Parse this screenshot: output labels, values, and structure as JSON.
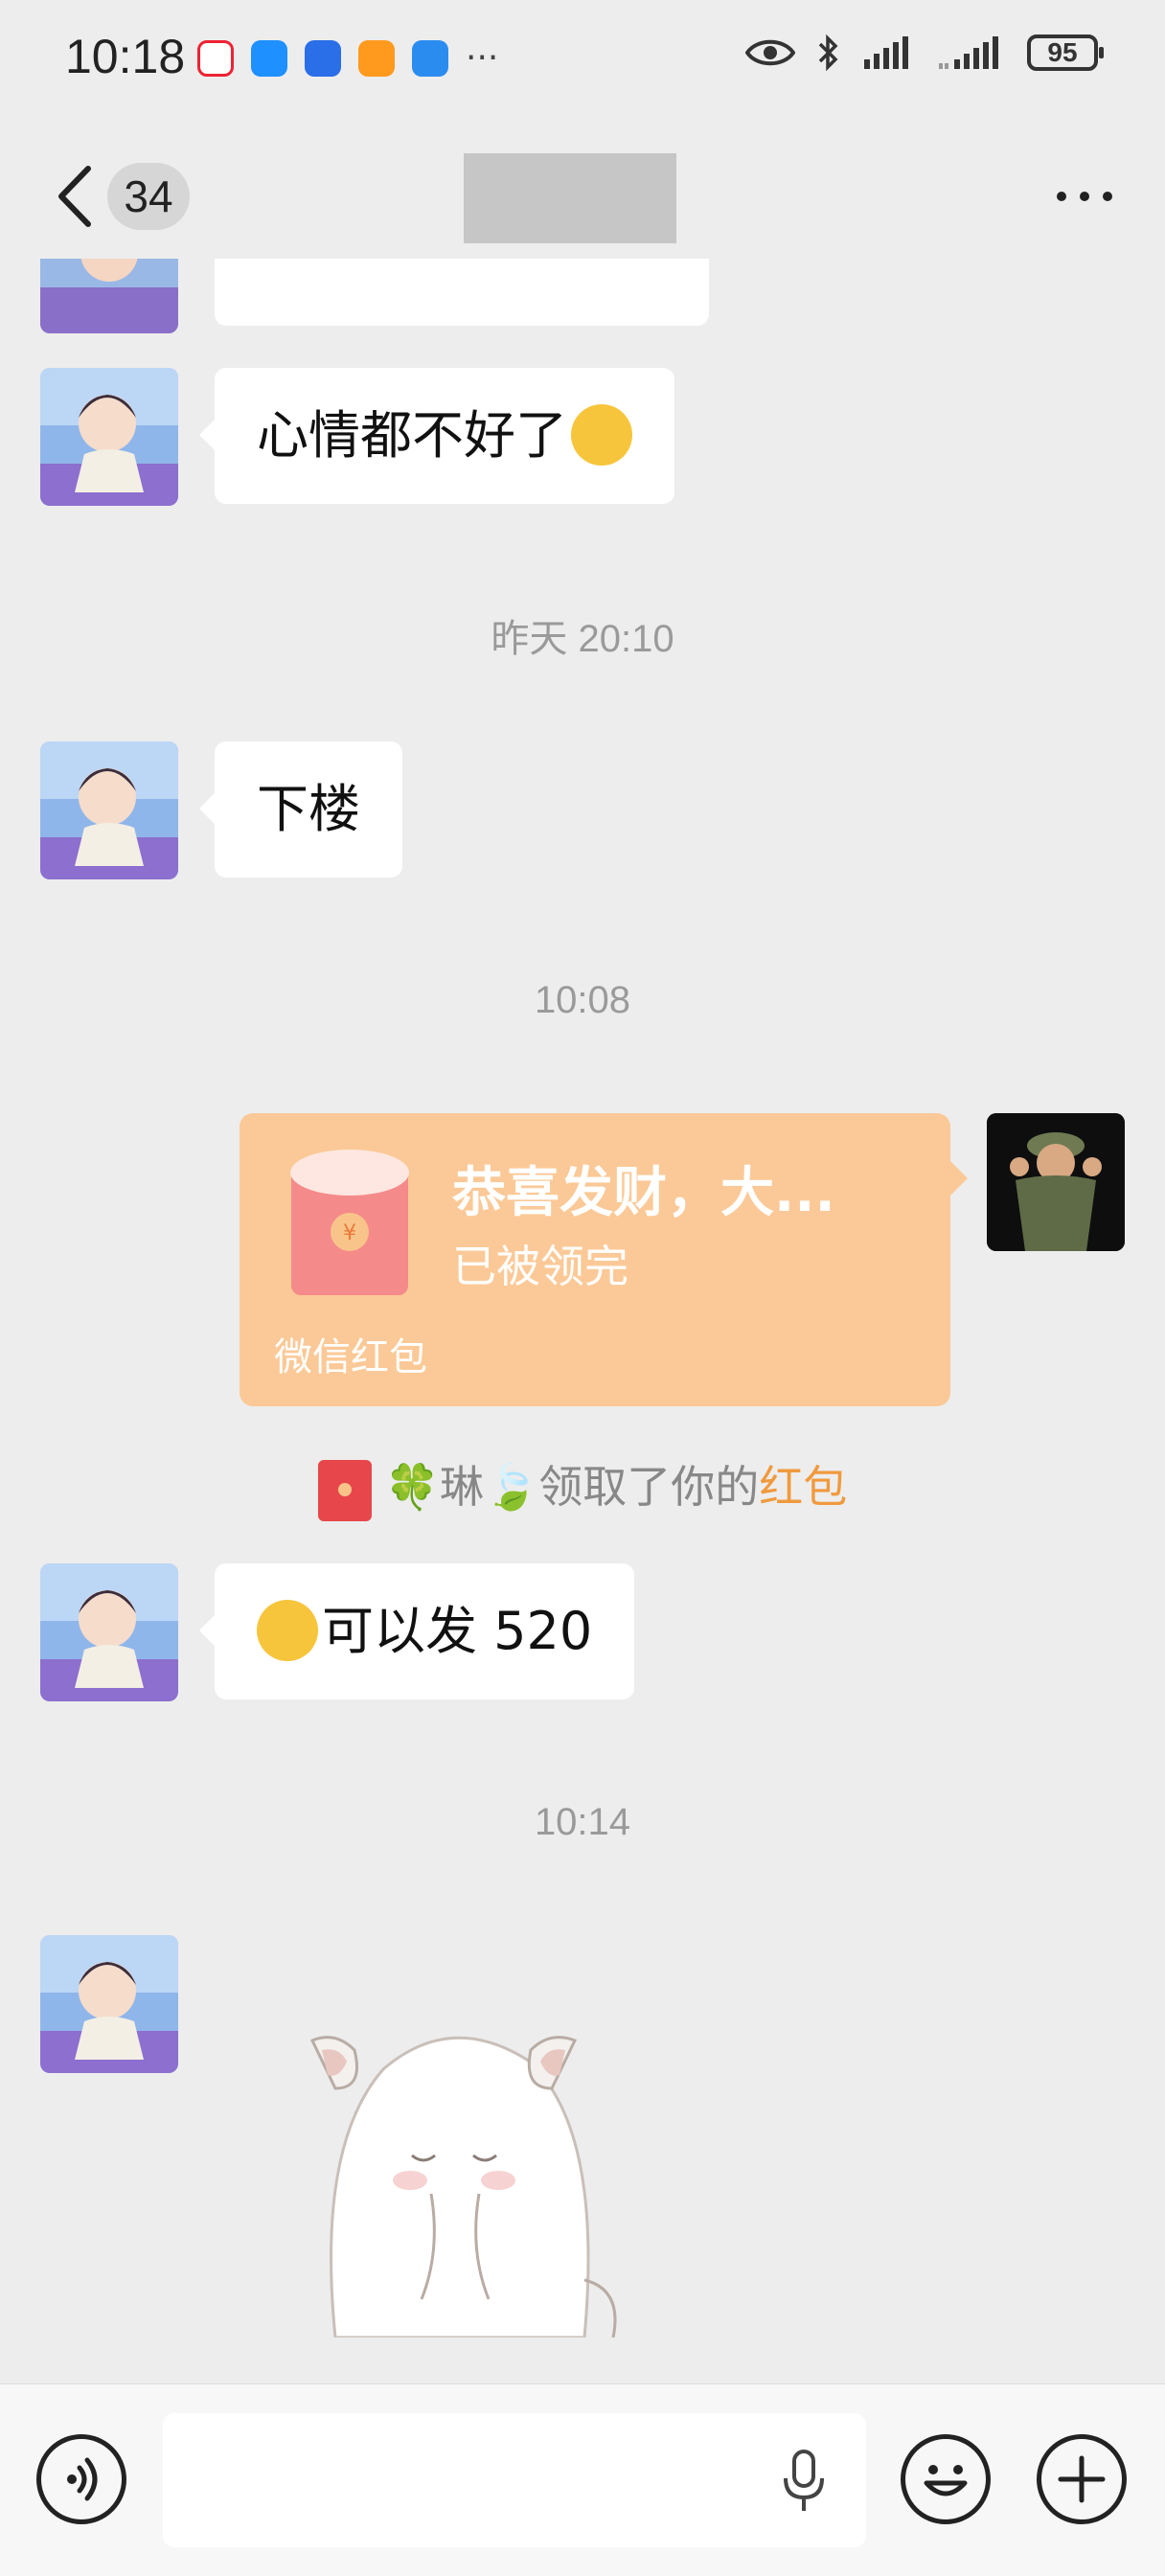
{
  "status_bar": {
    "time": "10:18",
    "app_icons": [
      "toutiao-icon",
      "messages-icon",
      "browser-icon",
      "gallery-icon",
      "weather-icon"
    ],
    "overflow": "···",
    "battery": "95"
  },
  "nav": {
    "unread_count": "34",
    "title": ""
  },
  "messages": {
    "m1_text": "心情都不好了",
    "m1_emoji": "facepalm-emoji",
    "ts1": "昨天 20:10",
    "m2_text": "下楼",
    "ts2": "10:08",
    "red_packet": {
      "title": "恭喜发财，大...",
      "status": "已被领完",
      "label": "微信红包"
    },
    "notice": {
      "prefix": "🍀琳🍃领取了你的",
      "link": "红包"
    },
    "m3_text": "可以发 520",
    "ts3": "10:14",
    "sticker": "hamster-sticker"
  },
  "input": {
    "placeholder": ""
  },
  "colors": {
    "background": "#ededed",
    "bubble": "#ffffff",
    "red_packet": "#fbc997",
    "accent": "#f09a3e"
  }
}
